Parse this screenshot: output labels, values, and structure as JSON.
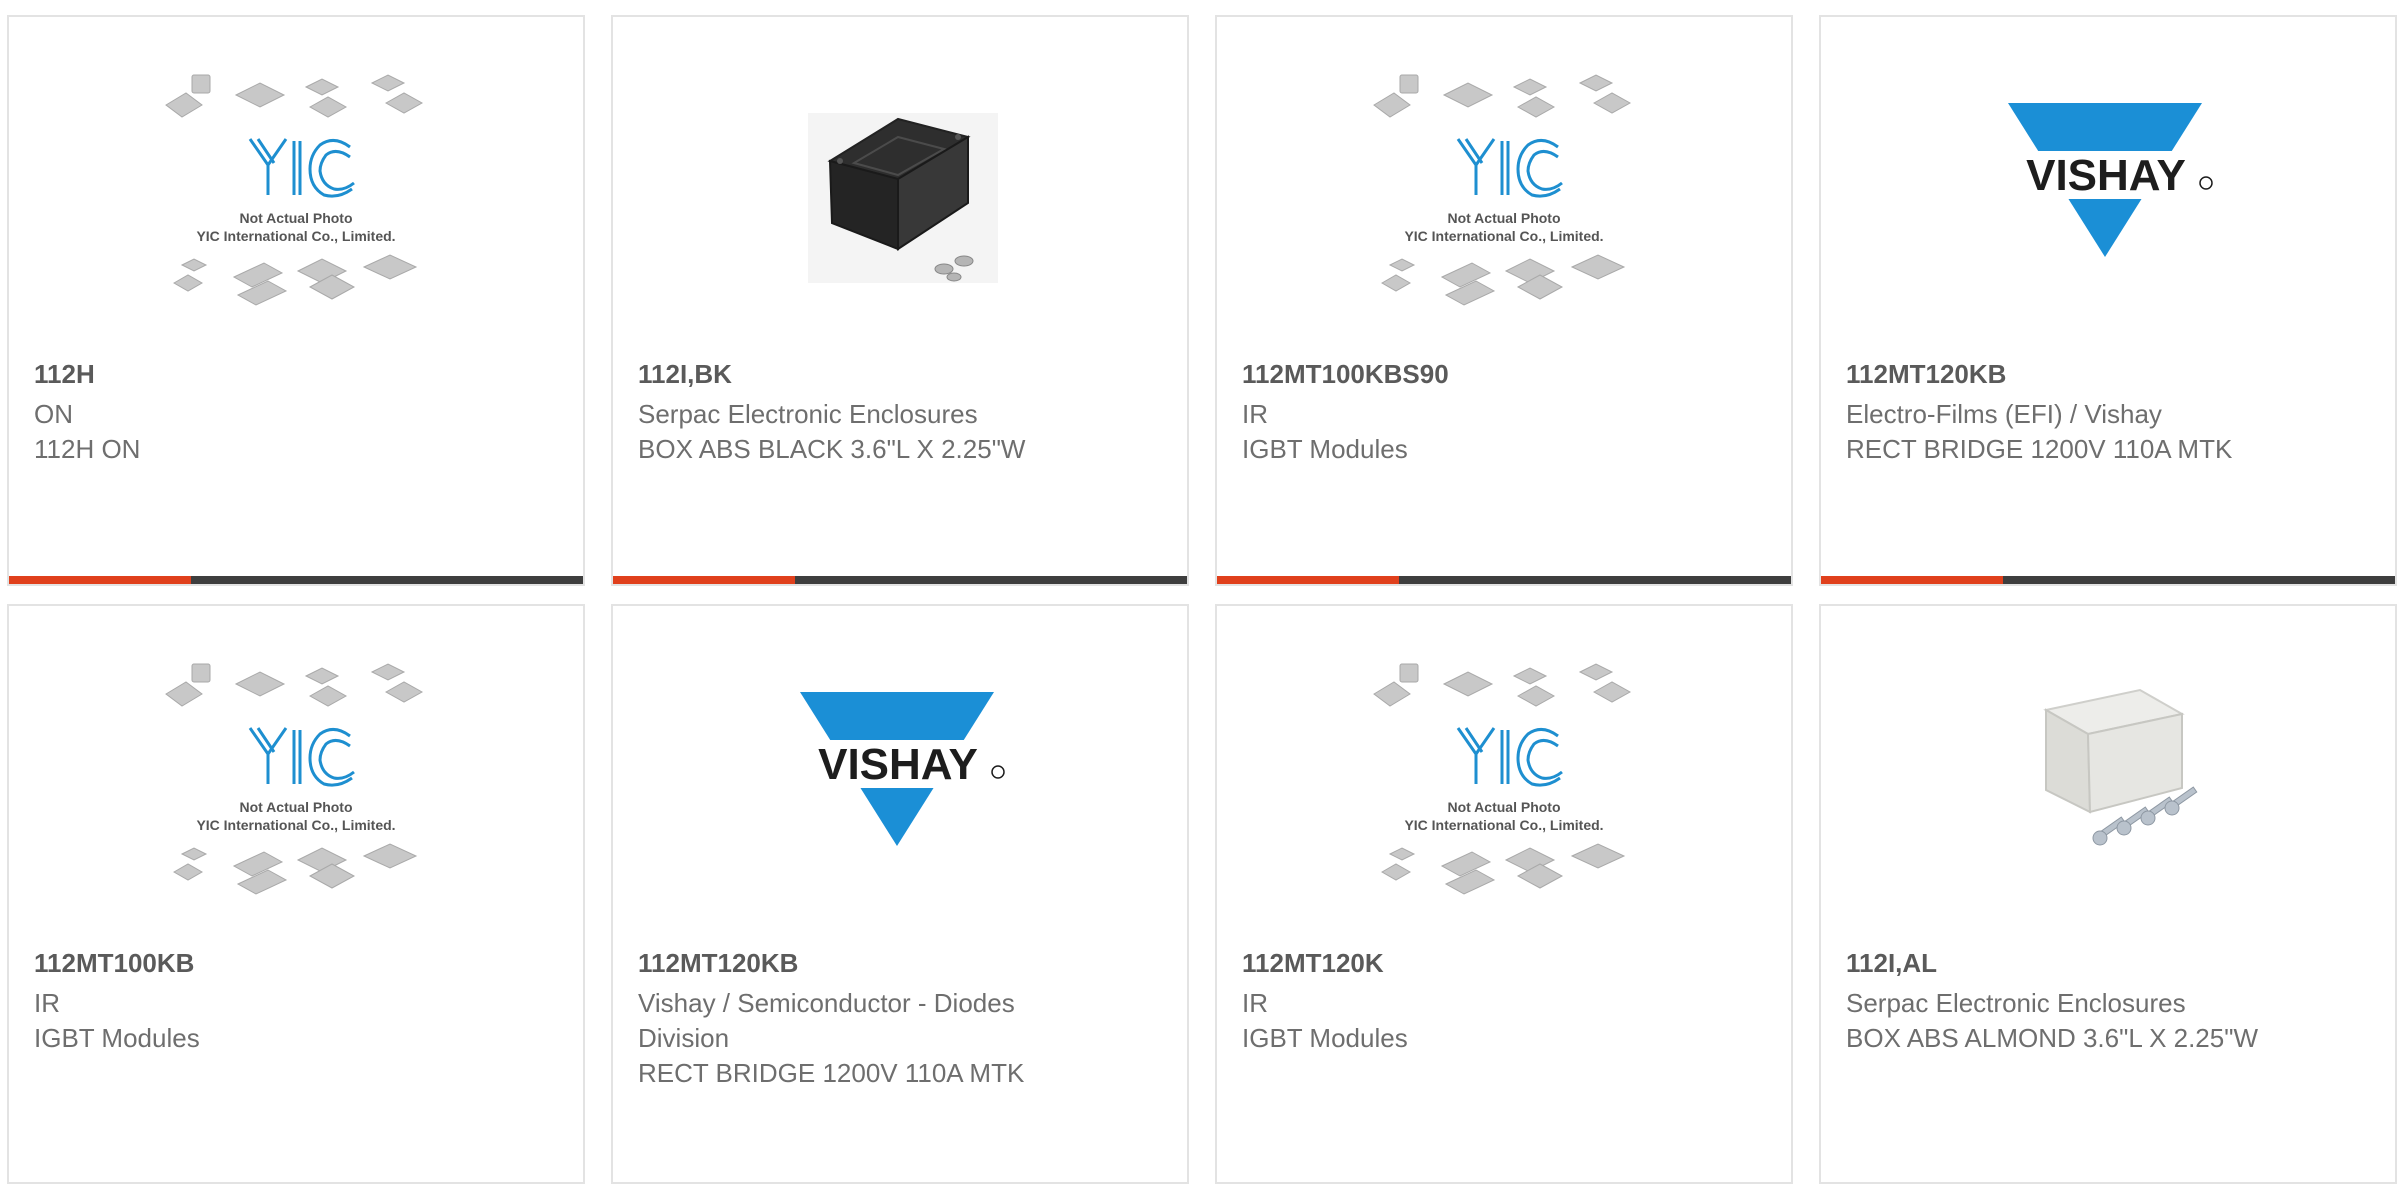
{
  "colors": {
    "accent": "#e0401c",
    "bar": "#3e3e3e",
    "border": "#e3e3e3",
    "yic_blue": "#1e8fd0",
    "vishay_blue": "#1b8fd6"
  },
  "placeholder": {
    "line1": "Not Actual Photo",
    "line2": "YIC International Co., Limited."
  },
  "vishay": {
    "wordmark": "VISHAY"
  },
  "cards": [
    {
      "part": "112H",
      "line1": "ON",
      "line2": "112H ON",
      "image": "yic-placeholder"
    },
    {
      "part": "112I,BK",
      "line1": "Serpac Electronic Enclosures",
      "line2": "BOX ABS BLACK 3.6\"L X 2.25\"W",
      "image": "black-enclosure"
    },
    {
      "part": "112MT100KBS90",
      "line1": "IR",
      "line2": "IGBT Modules",
      "image": "yic-placeholder"
    },
    {
      "part": "112MT120KB",
      "line1": "Electro-Films (EFI) / Vishay",
      "line2": "RECT BRIDGE 1200V 110A MTK",
      "image": "vishay-logo"
    },
    {
      "part": "112MT100KB",
      "line1": "IR",
      "line2": "IGBT Modules",
      "image": "yic-placeholder"
    },
    {
      "part": "112MT120KB",
      "line1": "Vishay / Semiconductor - Diodes Division",
      "line2": "RECT BRIDGE 1200V 110A MTK",
      "image": "vishay-logo"
    },
    {
      "part": "112MT120K",
      "line1": "IR",
      "line2": "IGBT Modules",
      "image": "yic-placeholder"
    },
    {
      "part": "112I,AL",
      "line1": "Serpac Electronic Enclosures",
      "line2": "BOX ABS ALMOND 3.6\"L X 2.25\"W",
      "image": "almond-enclosure"
    }
  ]
}
